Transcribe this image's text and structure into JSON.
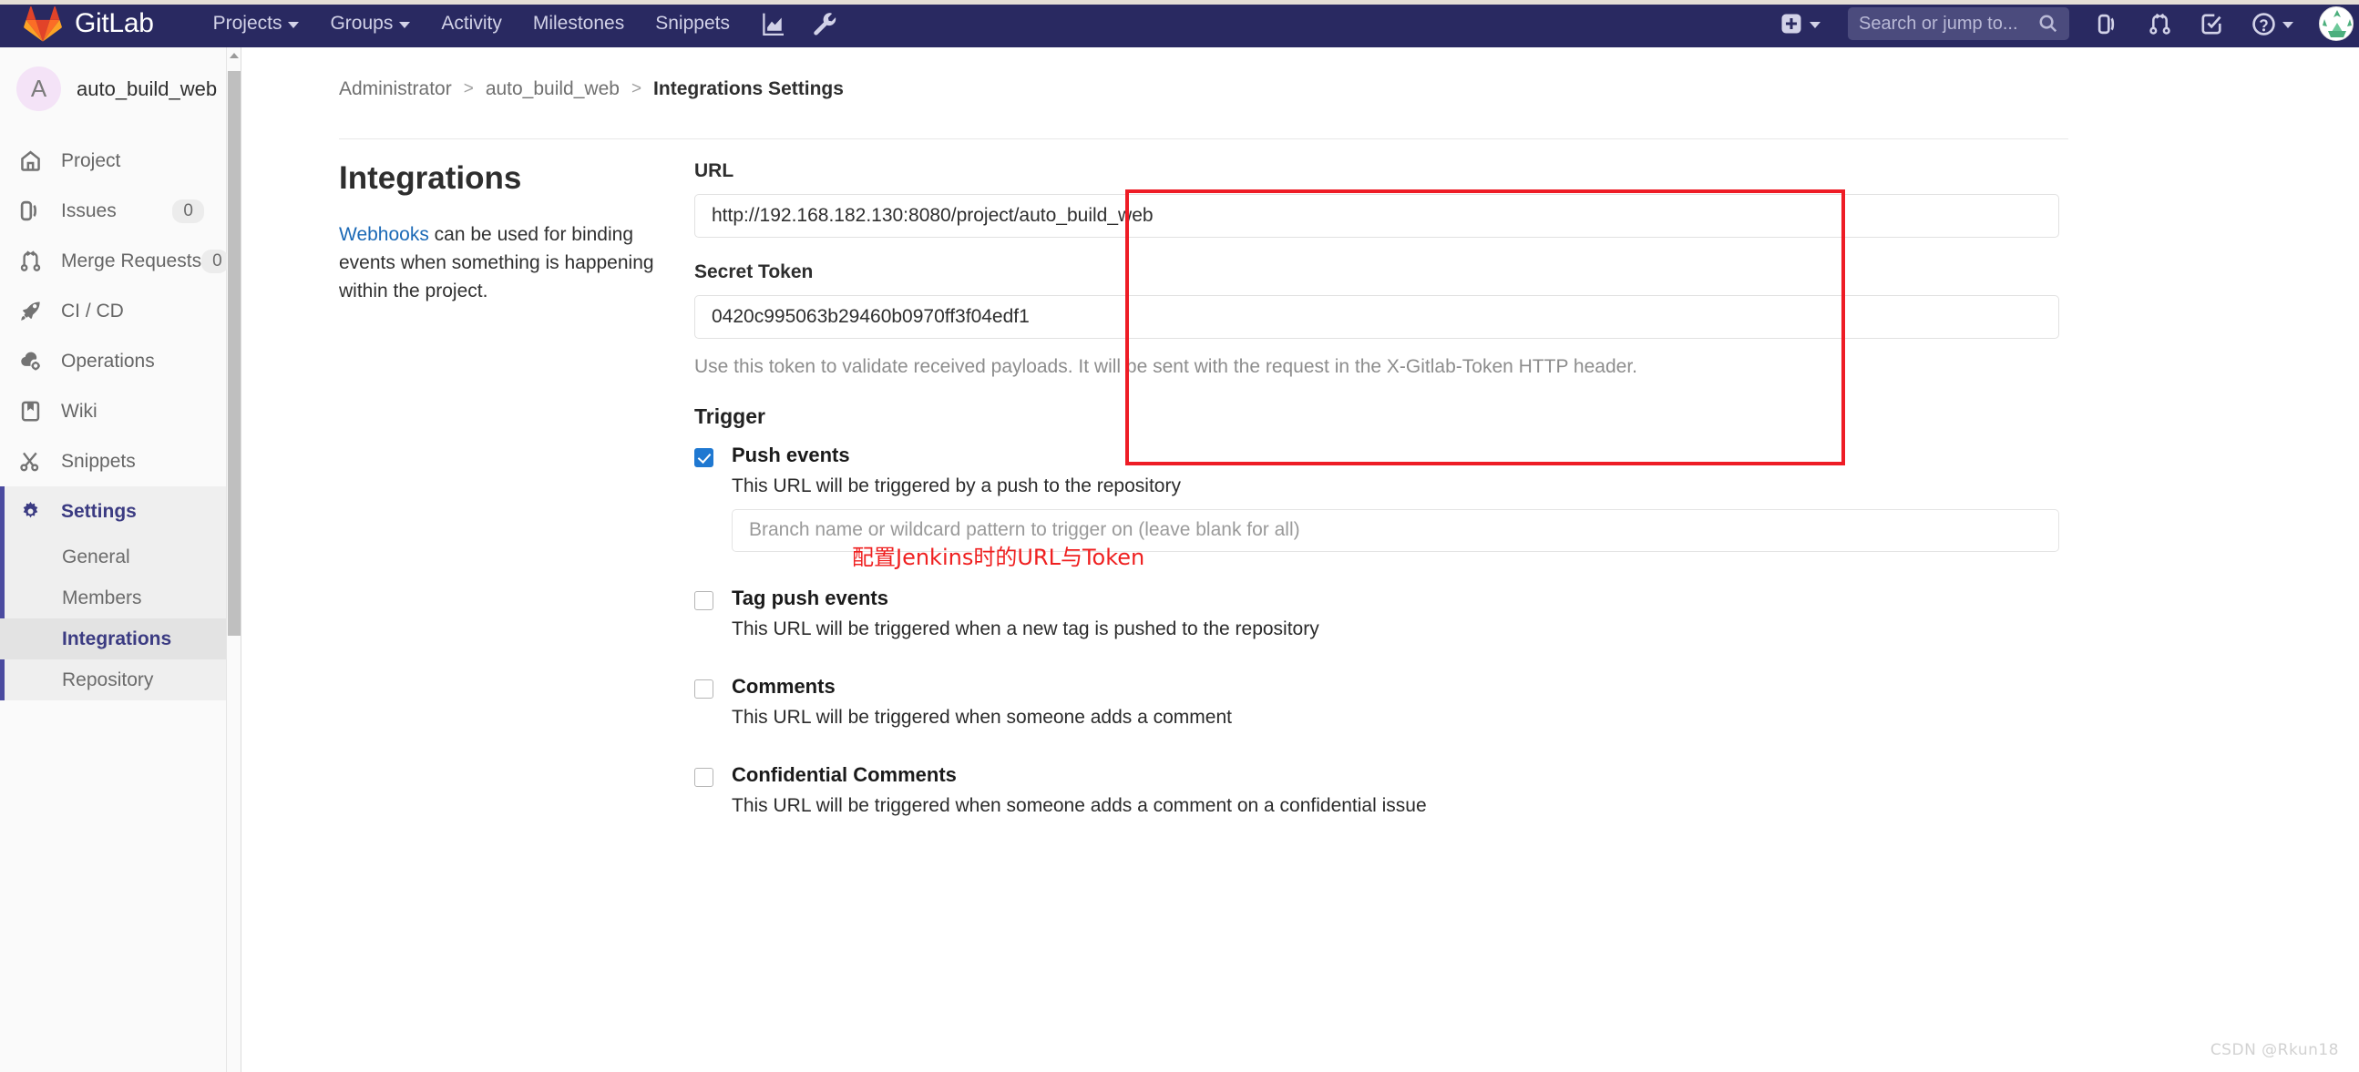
{
  "topbar": {
    "brand": "GitLab",
    "nav": [
      {
        "label": "Projects",
        "has_caret": true,
        "icon": "chevron-down-icon"
      },
      {
        "label": "Groups",
        "has_caret": true,
        "icon": "chevron-down-icon"
      },
      {
        "label": "Activity",
        "has_caret": false
      },
      {
        "label": "Milestones",
        "has_caret": false
      },
      {
        "label": "Snippets",
        "has_caret": false
      }
    ],
    "icon_buttons": [
      {
        "name": "analytics-chart-icon"
      },
      {
        "name": "wrench-icon"
      }
    ],
    "right": {
      "new_label": "",
      "new_icon": "plus-square-icon",
      "search_placeholder": "Search or jump to...",
      "search_icon": "search-icon",
      "icons": [
        {
          "name": "issues-icon"
        },
        {
          "name": "merge-request-icon"
        },
        {
          "name": "todos-check-icon"
        },
        {
          "name": "help-question-icon"
        }
      ],
      "avatar": "user-avatar"
    },
    "bg_color": "#292961"
  },
  "sidebar": {
    "project": {
      "initial": "A",
      "name": "auto_build_web"
    },
    "items": [
      {
        "label": "Project",
        "icon": "home-icon",
        "badge": null,
        "active": false
      },
      {
        "label": "Issues",
        "icon": "issues-icon",
        "badge": "0",
        "active": false
      },
      {
        "label": "Merge Requests",
        "icon": "merge-request-icon",
        "badge": "0",
        "active": false
      },
      {
        "label": "CI / CD",
        "icon": "rocket-icon",
        "badge": null,
        "active": false
      },
      {
        "label": "Operations",
        "icon": "cloud-gear-icon",
        "badge": null,
        "active": false
      },
      {
        "label": "Wiki",
        "icon": "book-icon",
        "badge": null,
        "active": false
      },
      {
        "label": "Snippets",
        "icon": "snippets-scissors-icon",
        "badge": null,
        "active": false
      },
      {
        "label": "Settings",
        "icon": "gear-icon",
        "badge": null,
        "active": true
      }
    ],
    "subitems": [
      {
        "label": "General",
        "current": false
      },
      {
        "label": "Members",
        "current": false
      },
      {
        "label": "Integrations",
        "current": true
      },
      {
        "label": "Repository",
        "current": false
      }
    ],
    "active_accent": "#4b4ba0"
  },
  "breadcrumb": {
    "items": [
      "Administrator",
      "auto_build_web",
      "Integrations Settings"
    ],
    "separator": ">"
  },
  "main": {
    "section_title": "Integrations",
    "description_link": "Webhooks",
    "description_rest": " can be used for binding events when something is happening within the project.",
    "url": {
      "label": "URL",
      "value": "http://192.168.182.130:8080/project/auto_build_web"
    },
    "secret_token": {
      "label": "Secret Token",
      "value": "0420c995063b29460b0970ff3f04edf1",
      "help": "Use this token to validate received payloads. It will be sent with the request in the X-Gitlab-Token HTTP header."
    },
    "trigger_title": "Trigger",
    "triggers": [
      {
        "label": "Push events",
        "checked": true,
        "description": "This URL will be triggered by a push to the repository",
        "input_placeholder": "Branch name or wildcard pattern to trigger on (leave blank for all)"
      },
      {
        "label": "Tag push events",
        "checked": false,
        "description": "This URL will be triggered when a new tag is pushed to the repository",
        "input_placeholder": null
      },
      {
        "label": "Comments",
        "checked": false,
        "description": "This URL will be triggered when someone adds a comment",
        "input_placeholder": null
      },
      {
        "label": "Confidential Comments",
        "checked": false,
        "description": "This URL will be triggered when someone adds a comment on a confidential issue",
        "input_placeholder": null
      }
    ]
  },
  "annotations": {
    "callout_text": "配置Jenkins时的URL与Token",
    "callout_color": "#ef2020",
    "box_color": "#ee1c25"
  },
  "watermark": "CSDN @Rkun18"
}
